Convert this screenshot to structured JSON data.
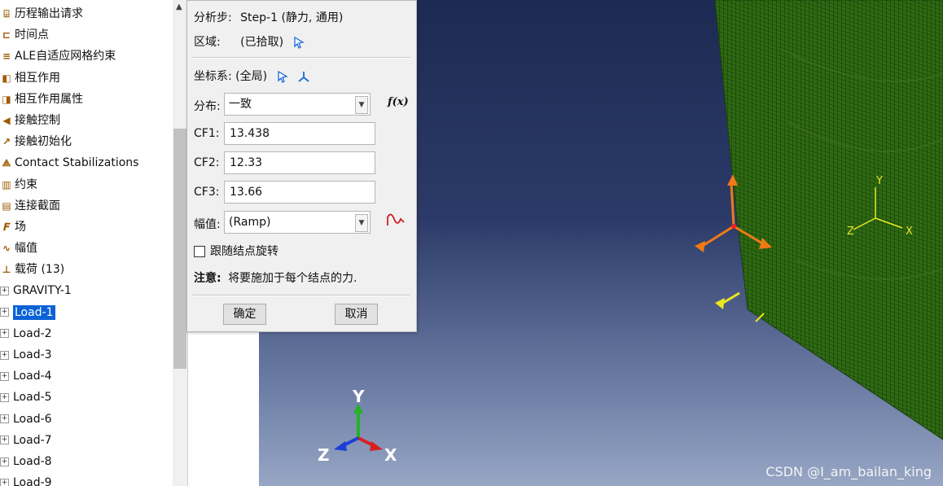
{
  "tree": {
    "items": [
      {
        "label": "历程输出请求",
        "icon": "history-output-icon"
      },
      {
        "label": "时间点",
        "icon": "time-points-icon"
      },
      {
        "label": "ALE自适应网格约束",
        "icon": "ale-constraint-icon"
      },
      {
        "label": "相互作用",
        "icon": "interaction-icon"
      },
      {
        "label": "相互作用属性",
        "icon": "interaction-property-icon"
      },
      {
        "label": "接触控制",
        "icon": "contact-control-icon"
      },
      {
        "label": "接触初始化",
        "icon": "contact-init-icon"
      },
      {
        "label": "Contact Stabilizations",
        "icon": "contact-stabilization-icon"
      },
      {
        "label": "约束",
        "icon": "constraint-icon"
      },
      {
        "label": "连接截面",
        "icon": "connector-section-icon"
      },
      {
        "label": "场",
        "icon": "field-icon"
      },
      {
        "label": "幅值",
        "icon": "amplitude-icon"
      },
      {
        "label": "载荷 (13)",
        "icon": "load-icon"
      }
    ],
    "loads": [
      "GRAVITY-1",
      "Load-1",
      "Load-2",
      "Load-3",
      "Load-4",
      "Load-5",
      "Load-6",
      "Load-7",
      "Load-8",
      "Load-9"
    ],
    "selected": "Load-1"
  },
  "dialog": {
    "step_label": "分析步:",
    "step_value": "Step-1 (静力, 通用)",
    "region_label": "区域:",
    "region_value": "(已拾取)",
    "csys_label": "坐标系: (全局)",
    "distribution_label": "分布:",
    "distribution_value": "一致",
    "fx_label": "f(x)",
    "cf1_label": "CF1:",
    "cf1_value": "13.438",
    "cf2_label": "CF2:",
    "cf2_value": "12.33",
    "cf3_label": "CF3:",
    "cf3_value": "13.66",
    "amplitude_label": "幅值:",
    "amplitude_value": "(Ramp)",
    "follow_rotation_label": "跟随结点旋转",
    "follow_rotation_checked": false,
    "note_label": "注意:",
    "note_text": "将要施加于每个结点的力.",
    "ok_label": "确定",
    "cancel_label": "取消"
  },
  "viewport": {
    "triad_x": "X",
    "triad_y": "Y",
    "triad_z": "Z",
    "local_x": "X",
    "local_y": "Y",
    "local_z": "Z",
    "watermark": "CSDN @I_am_bailan_king"
  },
  "colors": {
    "mesh_green": "#2e6a12",
    "selection_blue": "#0a62d6",
    "load_arrow_orange": "#f07a14",
    "load_arrow_yellow": "#e8e820",
    "background_top": "#1d2a52",
    "background_bottom": "#97a6c4"
  }
}
